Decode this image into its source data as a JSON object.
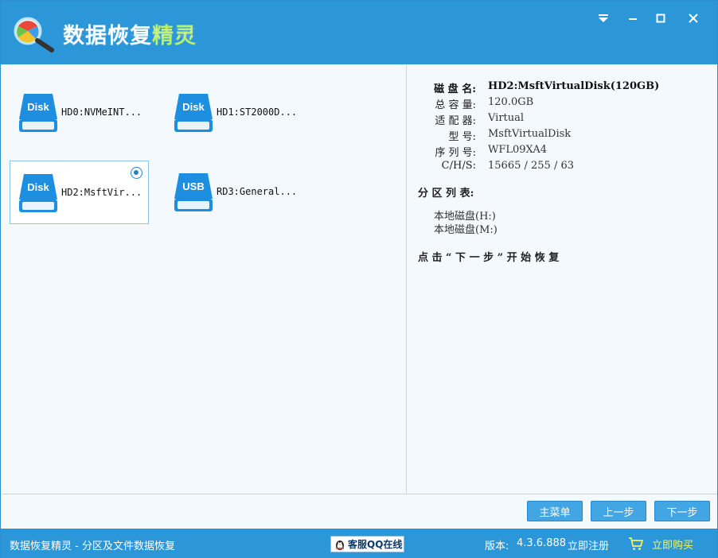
{
  "window": {
    "title_main": "数据恢复",
    "title_accent": "精灵",
    "controls": [
      "menu-dropdown",
      "minimize",
      "maximize",
      "close"
    ]
  },
  "disks": [
    {
      "icon_label": "Disk",
      "label": "HD0:NVMeINT...",
      "selected": false
    },
    {
      "icon_label": "Disk",
      "label": "HD1:ST2000D...",
      "selected": false
    },
    {
      "icon_label": "Disk",
      "label": "HD2:MsftVir...",
      "selected": true
    },
    {
      "icon_label": "USB",
      "label": "RD3:General...",
      "selected": false
    }
  ],
  "details": {
    "rows": [
      {
        "key": "磁 盘 名:",
        "value": "HD2:MsftVirtualDisk(120GB)"
      },
      {
        "key": "总 容 量:",
        "value": "120.0GB"
      },
      {
        "key": "适 配 器:",
        "value": "Virtual"
      },
      {
        "key": "型 号:",
        "value": "MsftVirtualDisk"
      },
      {
        "key": "序 列 号:",
        "value": "WFL09XA4"
      },
      {
        "key": "C/H/S:",
        "value": "15665 / 255 / 63"
      }
    ],
    "partition_title": "分 区 列 表:",
    "partitions": [
      "本地磁盘(H:)",
      "本地磁盘(M:)"
    ],
    "hint": "点 击 “ 下 一 步 ” 开 始 恢 复"
  },
  "buttons": {
    "main_menu": "主菜单",
    "prev": "上一步",
    "next": "下一步"
  },
  "status": {
    "app_desc": "数据恢复精灵 - 分区及文件数据恢复",
    "qq": "客服QQ在线",
    "version_label": "版本:",
    "version": "4.3.6.888",
    "register": "立即注册",
    "buy": "立即购买"
  },
  "colors": {
    "titlebar": "#2b96d8",
    "button": "#41a6e3",
    "accent_title": "#b9f06a",
    "buy_text": "#f5f55a",
    "disk_icon": "#1e8fe0"
  }
}
